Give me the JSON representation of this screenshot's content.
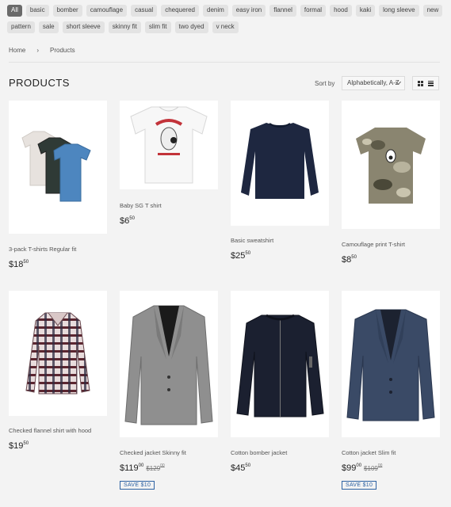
{
  "tags": [
    "All",
    "basic",
    "bomber",
    "camouflage",
    "casual",
    "chequered",
    "denim",
    "easy iron",
    "flannel",
    "formal",
    "hood",
    "kaki",
    "long sleeve",
    "new",
    "pattern",
    "sale",
    "short sleeve",
    "skinny fit",
    "slim fit",
    "two dyed",
    "v neck"
  ],
  "breadcrumb": {
    "home": "Home",
    "separator": "›",
    "current": "Products"
  },
  "page_title": "PRODUCTS",
  "sort": {
    "label": "Sort by",
    "value": "Alphabetically, A-Z"
  },
  "products": [
    {
      "name": "3-pack T-shirts Regular fit",
      "price_main": "$18",
      "price_cents": "50"
    },
    {
      "name": "Baby SG T shirt",
      "price_main": "$6",
      "price_cents": "50"
    },
    {
      "name": "Basic sweatshirt",
      "price_main": "$25",
      "price_cents": "50"
    },
    {
      "name": "Camouflage print T-shirt",
      "price_main": "$8",
      "price_cents": "50"
    },
    {
      "name": "Checked flannel shirt with hood",
      "price_main": "$19",
      "price_cents": "50"
    },
    {
      "name": "Checked jacket Skinny fit",
      "price_main": "$119",
      "price_cents": "00",
      "old_main": "$129",
      "old_cents": "00",
      "badge": "SAVE $10"
    },
    {
      "name": "Cotton bomber jacket",
      "price_main": "$45",
      "price_cents": "50"
    },
    {
      "name": "Cotton jacket Slim fit",
      "price_main": "$99",
      "price_cents": "00",
      "old_main": "$109",
      "old_cents": "00",
      "badge": "SAVE $10"
    }
  ],
  "colors": {
    "accent": "#2d62a3",
    "tag_active": "#6a6a6a",
    "page_bg": "#f3f3f3"
  }
}
